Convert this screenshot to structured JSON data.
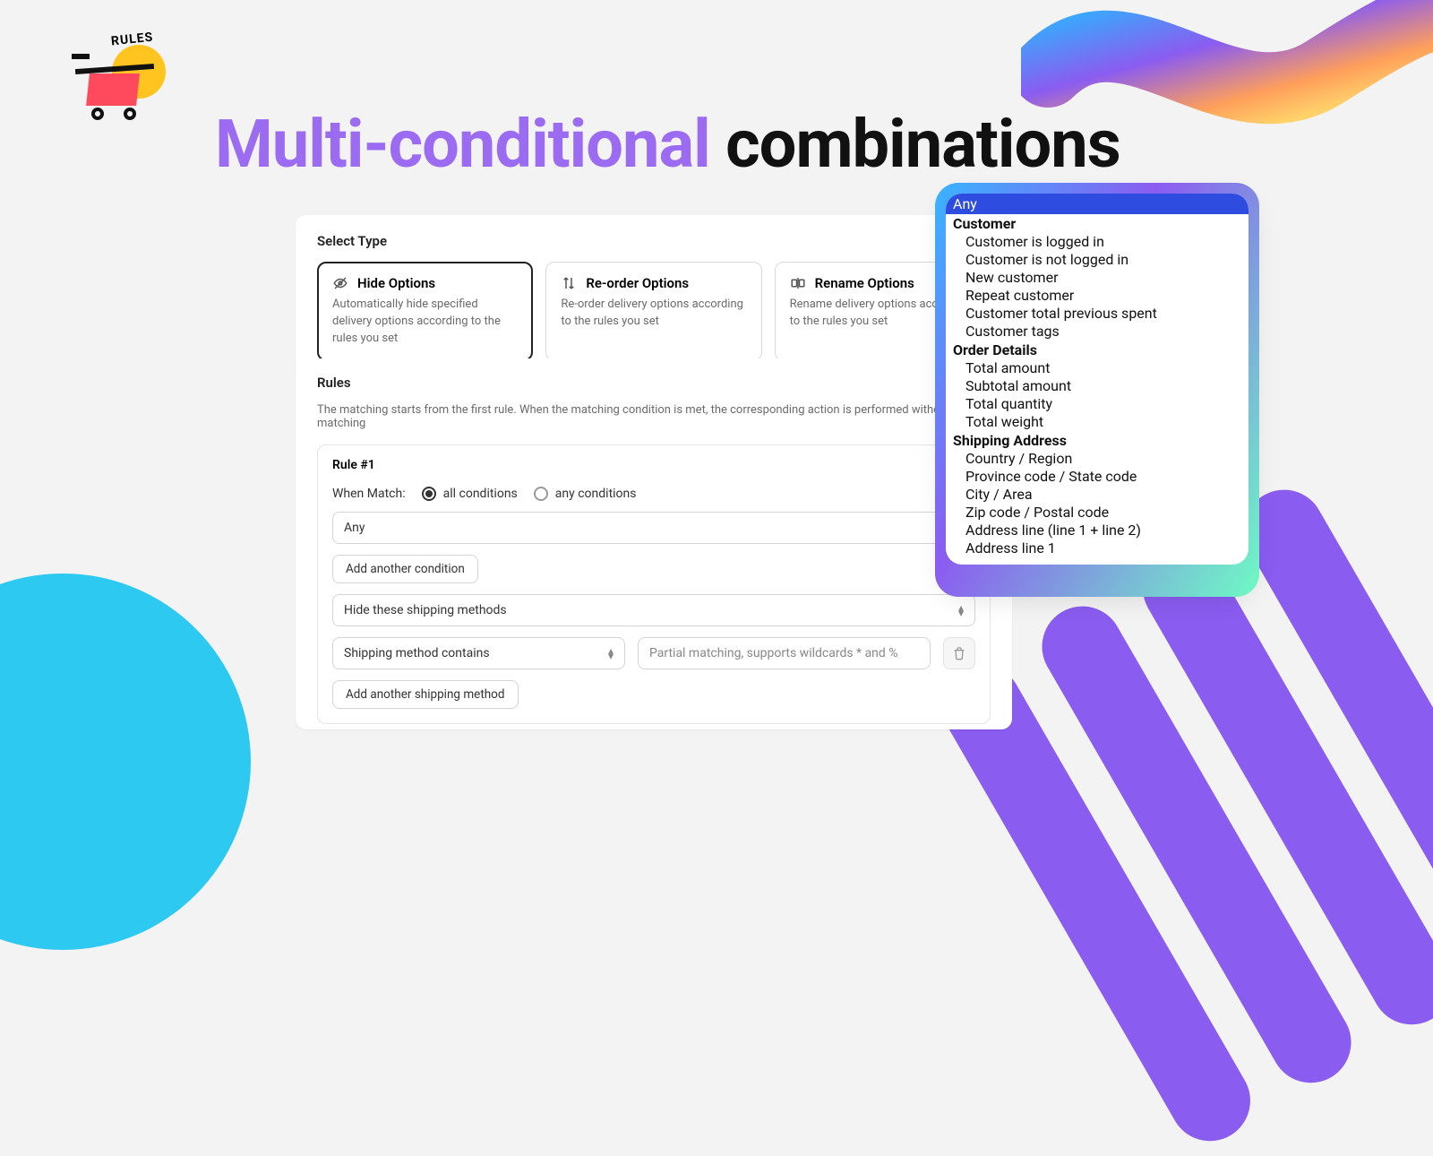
{
  "hero": {
    "rules_tag": "RULES",
    "title_purple": "Multi-conditional",
    "title_black": "combinations"
  },
  "select_type": {
    "label": "Select Type",
    "options": [
      {
        "id": "hide",
        "title": "Hide Options",
        "desc": "Automatically hide specified delivery options according to the rules you set",
        "selected": true
      },
      {
        "id": "reorder",
        "title": "Re-order Options",
        "desc": "Re-order delivery options according to the rules you set",
        "selected": false
      },
      {
        "id": "rename",
        "title": "Rename Options",
        "desc": "Rename delivery options according to the rules you set",
        "selected": false
      }
    ]
  },
  "rules": {
    "heading": "Rules",
    "description": "The matching starts from the first rule. When the matching condition is met, the corresponding action is performed without further matching",
    "rule1": {
      "title": "Rule #1",
      "when_label": "When Match:",
      "radio_all": "all conditions",
      "radio_any": "any conditions",
      "radio_selected": "all",
      "condition_value": "Any",
      "add_condition": "Add another condition",
      "action_value": "Hide these shipping methods",
      "method_field": "Shipping method contains",
      "method_placeholder": "Partial matching, supports wildcards * and %",
      "add_method": "Add another shipping method"
    }
  },
  "dropdown": {
    "selected": "Any",
    "groups": [
      {
        "label": "Customer",
        "items": [
          "Customer is logged in",
          "Customer is not logged in",
          "New customer",
          "Repeat customer",
          "Customer total previous spent",
          "Customer tags"
        ]
      },
      {
        "label": "Order Details",
        "items": [
          "Total amount",
          "Subtotal amount",
          "Total quantity",
          "Total weight"
        ]
      },
      {
        "label": "Shipping Address",
        "items": [
          "Country / Region",
          "Province code / State code",
          "City / Area",
          "Zip code / Postal code",
          "Address line (line 1 + line 2)",
          "Address line 1"
        ]
      }
    ]
  }
}
